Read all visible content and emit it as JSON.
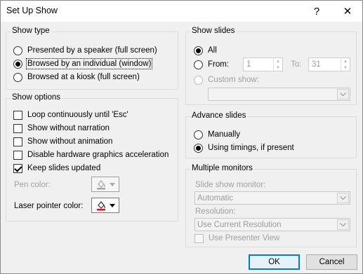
{
  "window": {
    "title": "Set Up Show",
    "help": "?",
    "close": "✕"
  },
  "show_type": {
    "legend": "Show type",
    "options": [
      {
        "label": "Presented by a speaker (full screen)",
        "checked": false
      },
      {
        "label": "Browsed by an individual (window)",
        "checked": true
      },
      {
        "label": "Browsed at a kiosk (full screen)",
        "checked": false
      }
    ]
  },
  "show_options": {
    "legend": "Show options",
    "checkboxes": [
      {
        "label": "Loop continuously until 'Esc'",
        "checked": false
      },
      {
        "label": "Show without narration",
        "checked": false
      },
      {
        "label": "Show without animation",
        "checked": false
      },
      {
        "label": "Disable hardware graphics acceleration",
        "checked": false
      },
      {
        "label": "Keep slides updated",
        "checked": true
      }
    ],
    "pen_color_label": "Pen color:",
    "laser_color_label": "Laser pointer color:",
    "laser_color": "#e81123"
  },
  "show_slides": {
    "legend": "Show slides",
    "all_label": "All",
    "from_label": "From:",
    "from_value": "1",
    "to_label": "To:",
    "to_value": "31",
    "custom_label": "Custom show:",
    "custom_value": ""
  },
  "advance_slides": {
    "legend": "Advance slides",
    "manually_label": "Manually",
    "timings_label": "Using timings, if present"
  },
  "multiple_monitors": {
    "legend": "Multiple monitors",
    "monitor_label": "Slide show monitor:",
    "monitor_value": "Automatic",
    "resolution_label": "Resolution:",
    "resolution_value": "Use Current Resolution",
    "presenter_view_label": "Use Presenter View"
  },
  "buttons": {
    "ok": "OK",
    "cancel": "Cancel"
  }
}
